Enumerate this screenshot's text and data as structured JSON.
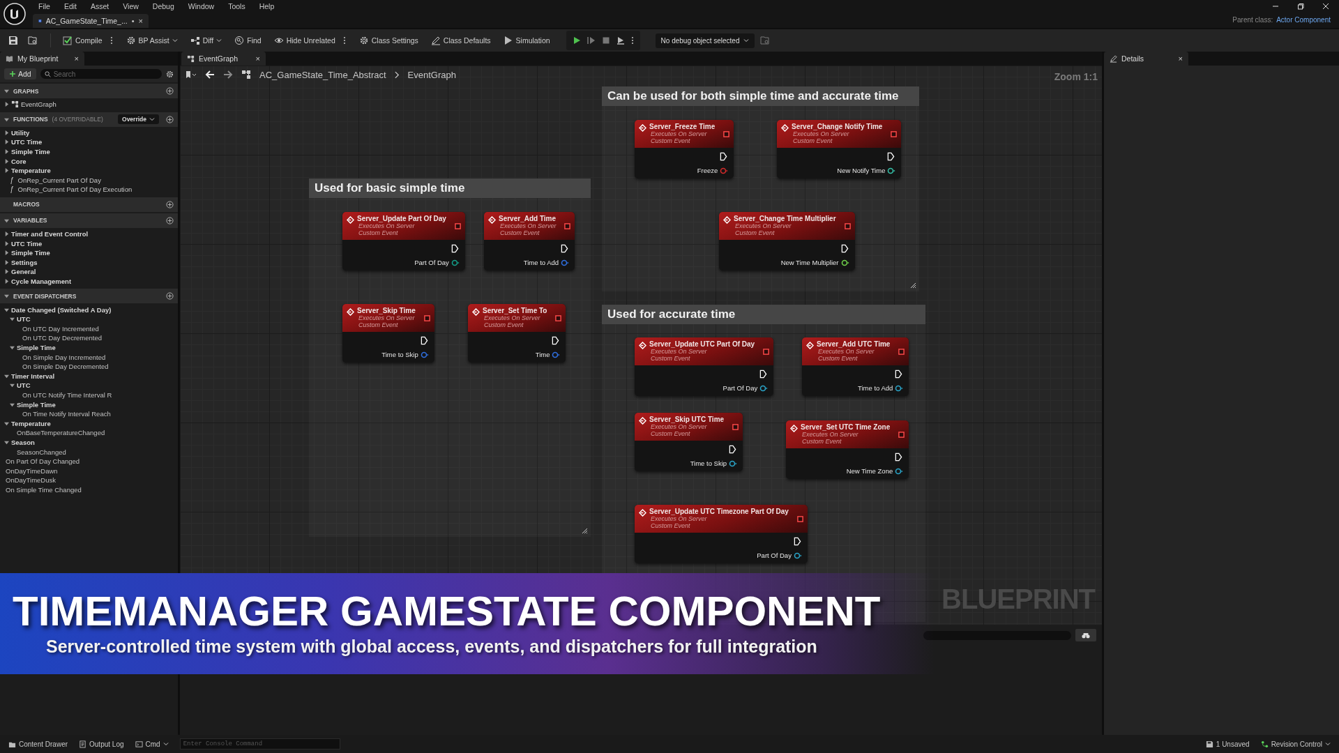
{
  "menu_bar": [
    "File",
    "Edit",
    "Asset",
    "View",
    "Debug",
    "Window",
    "Tools",
    "Help"
  ],
  "document_tab": {
    "label": "AC_GameState_Time_...",
    "modified": "•",
    "close": "×"
  },
  "parent_class": {
    "label": "Parent class:",
    "value": "Actor Component"
  },
  "toolbar": {
    "buttons": [
      {
        "label": "Compile",
        "dropdown": false
      },
      {
        "label": "BP Assist",
        "dropdown": true
      },
      {
        "label": "Diff",
        "dropdown": true
      },
      {
        "label": "Find",
        "dropdown": false
      },
      {
        "label": "Hide Unrelated",
        "dropdown": false
      },
      {
        "label": "Class Settings",
        "dropdown": false
      },
      {
        "label": "Class Defaults",
        "dropdown": false
      },
      {
        "label": "Simulation",
        "dropdown": false
      }
    ],
    "debug_object": "No debug object selected"
  },
  "my_blueprint": {
    "tab": {
      "label": "My Blueprint",
      "close": "×"
    },
    "add_button": "Add",
    "search": {
      "placeholder": "Search"
    },
    "sections": [
      {
        "label": "GRAPHS",
        "expanded": true,
        "items": [
          {
            "label": "EventGraph",
            "kind": "graph",
            "expanded": false
          }
        ]
      },
      {
        "label": "FUNCTIONS",
        "note": "(4 OVERRIDABLE)",
        "dropdown": "Override",
        "expanded": true,
        "items": [
          {
            "label": "Utility",
            "kind": "category",
            "expanded": false
          },
          {
            "label": "UTC Time",
            "kind": "category",
            "expanded": false
          },
          {
            "label": "Simple Time",
            "kind": "category",
            "expanded": false
          },
          {
            "label": "Core",
            "kind": "category",
            "expanded": false
          },
          {
            "label": "Temperature",
            "kind": "category",
            "expanded": false
          },
          {
            "label": "OnRep_Current Part Of Day",
            "kind": "function",
            "glyph": "ƒ"
          },
          {
            "label": "OnRep_Current Part Of Day Execution",
            "kind": "function",
            "glyph": "ƒ"
          }
        ]
      },
      {
        "label": "MACROS"
      },
      {
        "label": "VARIABLES",
        "expanded": true,
        "items": [
          {
            "label": "Timer and Event Control",
            "kind": "category",
            "expanded": false
          },
          {
            "label": "UTC Time",
            "kind": "category",
            "expanded": false
          },
          {
            "label": "Simple Time",
            "kind": "category",
            "expanded": false
          },
          {
            "label": "Settings",
            "kind": "category",
            "expanded": false
          },
          {
            "label": "General",
            "kind": "category",
            "expanded": false
          },
          {
            "label": "Cycle Management",
            "kind": "category",
            "expanded": false
          }
        ]
      },
      {
        "label": "EVENT DISPATCHERS",
        "expanded": true,
        "items": [
          {
            "label": "Date Changed (Switched A Day)",
            "kind": "category",
            "expanded": true,
            "children": [
              {
                "label": "UTC",
                "kind": "category",
                "expanded": true,
                "children": [
                  {
                    "label": "On UTC Day Incremented",
                    "kind": "item"
                  },
                  {
                    "label": "On UTC Day Decremented",
                    "kind": "item"
                  }
                ]
              },
              {
                "label": "Simple Time",
                "kind": "category",
                "expanded": true,
                "children": [
                  {
                    "label": "On Simple Day Incremented",
                    "kind": "item"
                  },
                  {
                    "label": "On Simple Day Decremented",
                    "kind": "item"
                  }
                ]
              }
            ]
          },
          {
            "label": "Timer Interval",
            "kind": "category",
            "expanded": true,
            "children": [
              {
                "label": "UTC",
                "kind": "category",
                "expanded": true,
                "children": [
                  {
                    "label": "On UTC Notify Time Interval R",
                    "kind": "item"
                  }
                ]
              },
              {
                "label": "Simple Time",
                "kind": "category",
                "expanded": true,
                "children": [
                  {
                    "label": "On Time Notify Interval Reach",
                    "kind": "item"
                  }
                ]
              }
            ]
          },
          {
            "label": "Temperature",
            "kind": "category",
            "expanded": true,
            "children": [
              {
                "label": "OnBaseTemperatureChanged",
                "kind": "item"
              }
            ]
          },
          {
            "label": "Season",
            "kind": "category",
            "expanded": true,
            "children": [
              {
                "label": "SeasonChanged",
                "kind": "item"
              }
            ]
          },
          {
            "label": "On Part Of Day Changed",
            "kind": "item"
          },
          {
            "label": "OnDayTimeDawn",
            "kind": "item"
          },
          {
            "label": "OnDayTimeDusk",
            "kind": "item"
          },
          {
            "label": "On Simple Time Changed",
            "kind": "item"
          }
        ]
      }
    ]
  },
  "graph_tab": {
    "label": "EventGraph",
    "close": "×"
  },
  "breadcrumb": [
    "AC_GameState_Time_Abstract",
    "EventGraph"
  ],
  "zoom": "Zoom 1:1",
  "graph_label": "BLUEPRINT",
  "comments": [
    {
      "title": "Can be used for both simple time and accurate time",
      "nodes": [
        {
          "title": "Server_Freeze Time",
          "lines": [
            "Executes On Server",
            "Custom Event"
          ],
          "pin": "Freeze",
          "color": "#d42a2a"
        },
        {
          "title": "Server_Change Notify Time",
          "lines": [
            "Executes On Server",
            "Custom Event"
          ],
          "pin": "New Notify Time",
          "color": "#35c0a8"
        },
        {
          "title": "Server_Change Time Multiplier",
          "lines": [
            "Executes On Server",
            "Custom Event"
          ],
          "pin": "New Time Multiplier",
          "color": "#6fd14a"
        }
      ]
    },
    {
      "title": "Used for basic simple time",
      "nodes": [
        {
          "title": "Server_Update Part Of Day",
          "lines": [
            "Executes On Server",
            "Custom Event"
          ],
          "pin": "Part Of Day",
          "color": "#13a08a"
        },
        {
          "title": "Server_Add Time",
          "lines": [
            "Executes On Server",
            "Custom Event"
          ],
          "pin": "Time to Add",
          "color": "#2f6fe0"
        },
        {
          "title": "Server_Skip Time",
          "lines": [
            "Executes On Server",
            "Custom Event"
          ],
          "pin": "Time to Skip",
          "color": "#2f6fe0"
        },
        {
          "title": "Server_Set Time To",
          "lines": [
            "Executes On Server",
            "Custom Event"
          ],
          "pin": "Time",
          "color": "#2f6fe0"
        }
      ]
    },
    {
      "title": "Used for accurate time",
      "nodes": [
        {
          "title": "Server_Update UTC Part Of Day",
          "lines": [
            "Executes On Server",
            "Custom Event"
          ],
          "pin": "Part Of Day",
          "color": "#2aa4c8"
        },
        {
          "title": "Server_Add UTC Time",
          "lines": [
            "Executes On Server",
            "Custom Event"
          ],
          "pin": "Time to Add",
          "color": "#2aa4c8"
        },
        {
          "title": "Server_Skip UTC Time",
          "lines": [
            "Executes On Server",
            "Custom Event"
          ],
          "pin": "Time to Skip",
          "color": "#2aa4c8"
        },
        {
          "title": "Server_Set UTC Time Zone",
          "lines": [
            "Executes On Server",
            "Custom Event"
          ],
          "pin": "New Time Zone",
          "color": "#2aa4c8"
        },
        {
          "title": "Server_Update UTC Timezone Part Of Day",
          "lines": [
            "Executes On Server",
            "Custom Event"
          ],
          "pin": "Part Of Day",
          "color": "#2aa4c8"
        }
      ]
    }
  ],
  "details_tab": {
    "label": "Details",
    "close": "×"
  },
  "banner": {
    "title": "TIMEMANAGER GAMESTATE COMPONENT",
    "subtitle": "Server-controlled time system with global access, events, and dispatchers for full integration"
  },
  "status_bar": {
    "content_drawer": "Content Drawer",
    "output_log": "Output Log",
    "cmd": "Cmd",
    "console": {
      "placeholder": "Enter Console Command"
    },
    "unsaved": "1 Unsaved",
    "revision_control": "Revision Control"
  }
}
